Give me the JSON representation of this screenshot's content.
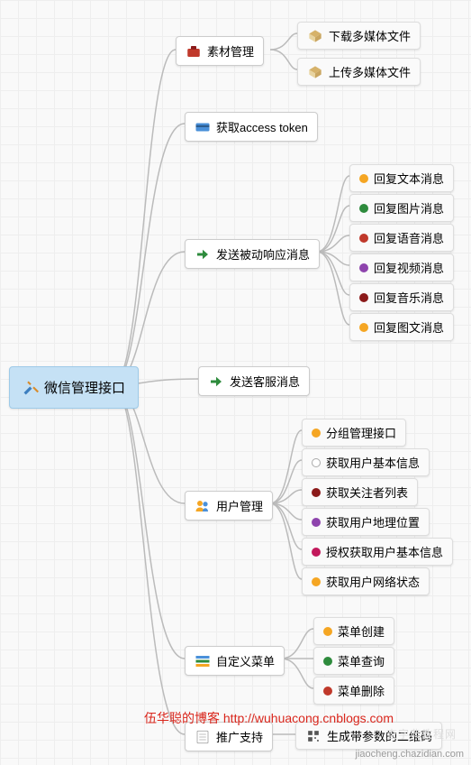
{
  "root": {
    "label": "微信管理接口"
  },
  "branches": {
    "material": {
      "label": "素材管理"
    },
    "token": {
      "label": "获取access token"
    },
    "passive": {
      "label": "发送被动响应消息"
    },
    "customer": {
      "label": "发送客服消息"
    },
    "user": {
      "label": "用户管理"
    },
    "menu": {
      "label": "自定义菜单"
    },
    "promo": {
      "label": "推广支持"
    }
  },
  "leaves": {
    "material": [
      {
        "label": "下载多媒体文件"
      },
      {
        "label": "上传多媒体文件"
      }
    ],
    "passive": [
      {
        "label": "回复文本消息"
      },
      {
        "label": "回复图片消息"
      },
      {
        "label": "回复语音消息"
      },
      {
        "label": "回复视频消息"
      },
      {
        "label": "回复音乐消息"
      },
      {
        "label": "回复图文消息"
      }
    ],
    "user": [
      {
        "label": "分组管理接口"
      },
      {
        "label": "获取用户基本信息"
      },
      {
        "label": "获取关注者列表"
      },
      {
        "label": "获取用户地理位置"
      },
      {
        "label": "授权获取用户基本信息"
      },
      {
        "label": "获取用户网络状态"
      }
    ],
    "menu": [
      {
        "label": "菜单创建"
      },
      {
        "label": "菜单查询"
      },
      {
        "label": "菜单删除"
      }
    ],
    "promo": [
      {
        "label": "生成带参数的二维码"
      }
    ]
  },
  "watermarks": {
    "blog": "伍华聪的博客 http://wuhuacong.cnblogs.com",
    "siteText": "jiaocheng.chazidian.com",
    "siteLabel": "查字典教程网"
  }
}
